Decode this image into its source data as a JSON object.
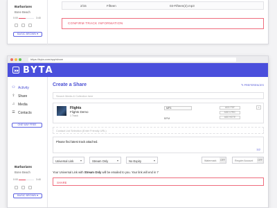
{
  "top": {
    "row": {
      "num": "2/15",
      "title": "Fifteen",
      "file": "03-Fifteen(2).mp3"
    },
    "confirm_label": "CONFIRM TRACK INFORMATION"
  },
  "player": {
    "artist": "Barbarians",
    "album": "Bone Beach",
    "basic_label": "BASIC BROWN ▾"
  },
  "browser": {
    "url": "https://byta.com/app/share"
  },
  "brand": {
    "name": "BYTA",
    "color": "#4a4fdc"
  },
  "nav": [
    {
      "label": "Activity",
      "icon": "activity-icon",
      "active": true
    },
    {
      "label": "Share",
      "icon": "share-icon"
    },
    {
      "label": "Media",
      "icon": "music-icon"
    },
    {
      "label": "Contacts",
      "icon": "contacts-icon"
    }
  ],
  "side_button": "ONE WAY FREE",
  "main": {
    "title": "Create a Share",
    "prefs": "✎ PREFERENCES",
    "search_placeholder": "Search Media & Collection here",
    "track": {
      "name": "Flights",
      "demo": "Flights Demo",
      "count": "1 Track",
      "format": "MP3",
      "format_sub": "BPM",
      "buttons": [
        "ADD PDF",
        "ADD LYRIC",
        "ADD NOTE"
      ]
    },
    "contacts_placeholder": "Contact List Selection (Enter Friendly URL)",
    "message": "Please find latest track attached.",
    "char_count": "112",
    "selects": [
      "Universal Link",
      "Stream Only",
      "No Expiry"
    ],
    "watermark": {
      "label": "Watermark",
      "value": "OFF"
    },
    "password": {
      "label": "Require Account",
      "value": "OFF"
    },
    "note_prefix": "Your Universal Link with ",
    "note_bold": "Stream Only",
    "note_suffix": " will be emailed to you. Your link will end in 7",
    "share_label": "SHARE"
  }
}
